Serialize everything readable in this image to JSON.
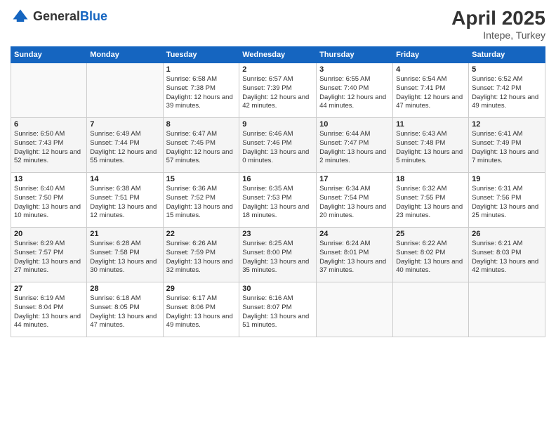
{
  "header": {
    "logo_general": "General",
    "logo_blue": "Blue",
    "month_title": "April 2025",
    "subtitle": "Intepe, Turkey"
  },
  "weekdays": [
    "Sunday",
    "Monday",
    "Tuesday",
    "Wednesday",
    "Thursday",
    "Friday",
    "Saturday"
  ],
  "weeks": [
    [
      {
        "day": "",
        "info": ""
      },
      {
        "day": "",
        "info": ""
      },
      {
        "day": "1",
        "info": "Sunrise: 6:58 AM\nSunset: 7:38 PM\nDaylight: 12 hours and 39 minutes."
      },
      {
        "day": "2",
        "info": "Sunrise: 6:57 AM\nSunset: 7:39 PM\nDaylight: 12 hours and 42 minutes."
      },
      {
        "day": "3",
        "info": "Sunrise: 6:55 AM\nSunset: 7:40 PM\nDaylight: 12 hours and 44 minutes."
      },
      {
        "day": "4",
        "info": "Sunrise: 6:54 AM\nSunset: 7:41 PM\nDaylight: 12 hours and 47 minutes."
      },
      {
        "day": "5",
        "info": "Sunrise: 6:52 AM\nSunset: 7:42 PM\nDaylight: 12 hours and 49 minutes."
      }
    ],
    [
      {
        "day": "6",
        "info": "Sunrise: 6:50 AM\nSunset: 7:43 PM\nDaylight: 12 hours and 52 minutes."
      },
      {
        "day": "7",
        "info": "Sunrise: 6:49 AM\nSunset: 7:44 PM\nDaylight: 12 hours and 55 minutes."
      },
      {
        "day": "8",
        "info": "Sunrise: 6:47 AM\nSunset: 7:45 PM\nDaylight: 12 hours and 57 minutes."
      },
      {
        "day": "9",
        "info": "Sunrise: 6:46 AM\nSunset: 7:46 PM\nDaylight: 13 hours and 0 minutes."
      },
      {
        "day": "10",
        "info": "Sunrise: 6:44 AM\nSunset: 7:47 PM\nDaylight: 13 hours and 2 minutes."
      },
      {
        "day": "11",
        "info": "Sunrise: 6:43 AM\nSunset: 7:48 PM\nDaylight: 13 hours and 5 minutes."
      },
      {
        "day": "12",
        "info": "Sunrise: 6:41 AM\nSunset: 7:49 PM\nDaylight: 13 hours and 7 minutes."
      }
    ],
    [
      {
        "day": "13",
        "info": "Sunrise: 6:40 AM\nSunset: 7:50 PM\nDaylight: 13 hours and 10 minutes."
      },
      {
        "day": "14",
        "info": "Sunrise: 6:38 AM\nSunset: 7:51 PM\nDaylight: 13 hours and 12 minutes."
      },
      {
        "day": "15",
        "info": "Sunrise: 6:36 AM\nSunset: 7:52 PM\nDaylight: 13 hours and 15 minutes."
      },
      {
        "day": "16",
        "info": "Sunrise: 6:35 AM\nSunset: 7:53 PM\nDaylight: 13 hours and 18 minutes."
      },
      {
        "day": "17",
        "info": "Sunrise: 6:34 AM\nSunset: 7:54 PM\nDaylight: 13 hours and 20 minutes."
      },
      {
        "day": "18",
        "info": "Sunrise: 6:32 AM\nSunset: 7:55 PM\nDaylight: 13 hours and 23 minutes."
      },
      {
        "day": "19",
        "info": "Sunrise: 6:31 AM\nSunset: 7:56 PM\nDaylight: 13 hours and 25 minutes."
      }
    ],
    [
      {
        "day": "20",
        "info": "Sunrise: 6:29 AM\nSunset: 7:57 PM\nDaylight: 13 hours and 27 minutes."
      },
      {
        "day": "21",
        "info": "Sunrise: 6:28 AM\nSunset: 7:58 PM\nDaylight: 13 hours and 30 minutes."
      },
      {
        "day": "22",
        "info": "Sunrise: 6:26 AM\nSunset: 7:59 PM\nDaylight: 13 hours and 32 minutes."
      },
      {
        "day": "23",
        "info": "Sunrise: 6:25 AM\nSunset: 8:00 PM\nDaylight: 13 hours and 35 minutes."
      },
      {
        "day": "24",
        "info": "Sunrise: 6:24 AM\nSunset: 8:01 PM\nDaylight: 13 hours and 37 minutes."
      },
      {
        "day": "25",
        "info": "Sunrise: 6:22 AM\nSunset: 8:02 PM\nDaylight: 13 hours and 40 minutes."
      },
      {
        "day": "26",
        "info": "Sunrise: 6:21 AM\nSunset: 8:03 PM\nDaylight: 13 hours and 42 minutes."
      }
    ],
    [
      {
        "day": "27",
        "info": "Sunrise: 6:19 AM\nSunset: 8:04 PM\nDaylight: 13 hours and 44 minutes."
      },
      {
        "day": "28",
        "info": "Sunrise: 6:18 AM\nSunset: 8:05 PM\nDaylight: 13 hours and 47 minutes."
      },
      {
        "day": "29",
        "info": "Sunrise: 6:17 AM\nSunset: 8:06 PM\nDaylight: 13 hours and 49 minutes."
      },
      {
        "day": "30",
        "info": "Sunrise: 6:16 AM\nSunset: 8:07 PM\nDaylight: 13 hours and 51 minutes."
      },
      {
        "day": "",
        "info": ""
      },
      {
        "day": "",
        "info": ""
      },
      {
        "day": "",
        "info": ""
      }
    ]
  ],
  "colors": {
    "header_bg": "#1565C0",
    "header_text": "#ffffff",
    "border": "#cccccc"
  }
}
